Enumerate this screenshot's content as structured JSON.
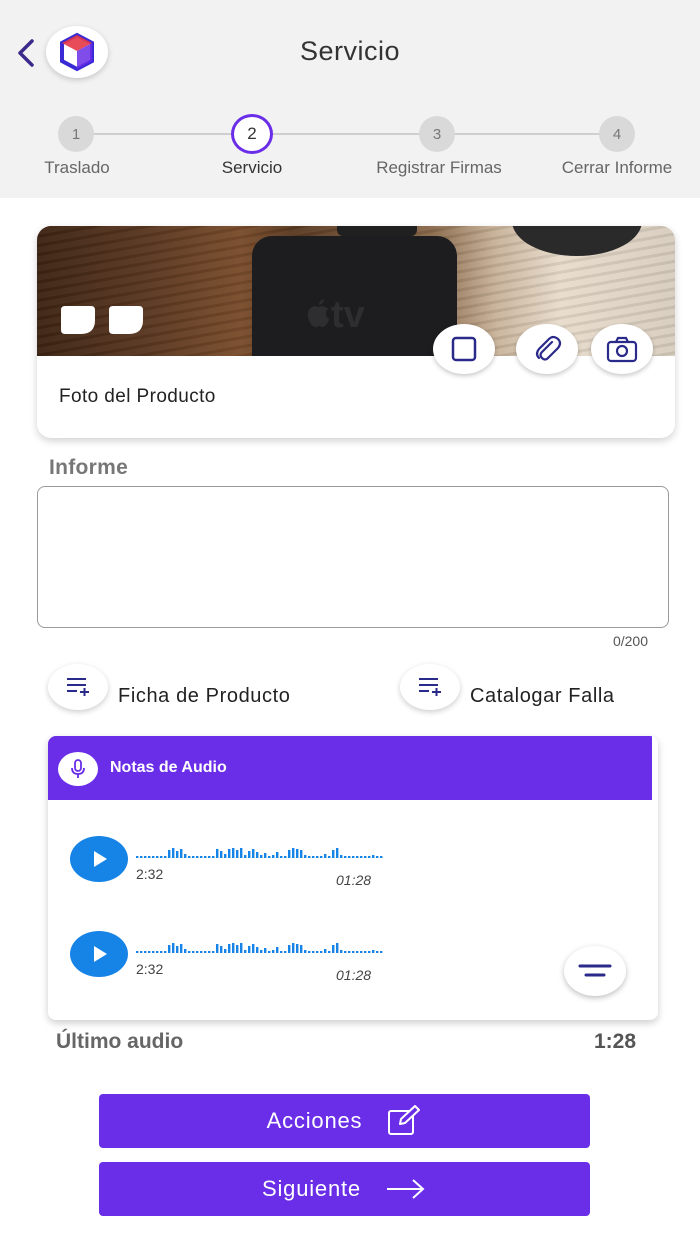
{
  "header": {
    "title": "Servicio",
    "back_icon": "chevron-left-icon",
    "logo_icon": "app-logo-icon"
  },
  "stepper": {
    "steps": [
      {
        "number": "1",
        "label": "Traslado"
      },
      {
        "number": "2",
        "label": "Servicio"
      },
      {
        "number": "3",
        "label": "Registrar Firmas"
      },
      {
        "number": "4",
        "label": "Cerrar Informe"
      }
    ],
    "active_index": 1
  },
  "product": {
    "label": "Foto del Producto",
    "photo_text": "tv",
    "actions": [
      "crop-square-icon",
      "paperclip-icon",
      "camera-icon"
    ]
  },
  "informe": {
    "label": "Informe",
    "value": "",
    "counter": "0/200"
  },
  "chips": {
    "ficha_label": "Ficha de Producto",
    "catalogar_label": "Catalogar Falla"
  },
  "audio": {
    "title": "Notas de Audio",
    "items": [
      {
        "duration": "2:32",
        "position": "01:28"
      },
      {
        "duration": "2:32",
        "position": "01:28"
      }
    ]
  },
  "last_audio": {
    "label": "Último audio",
    "value": "1:28"
  },
  "buttons": {
    "acciones_label": "Acciones",
    "siguiente_label": "Siguiente"
  },
  "colors": {
    "accent": "#6a2ee8",
    "play": "#1683e6",
    "header_bg": "#f2f2f2"
  }
}
